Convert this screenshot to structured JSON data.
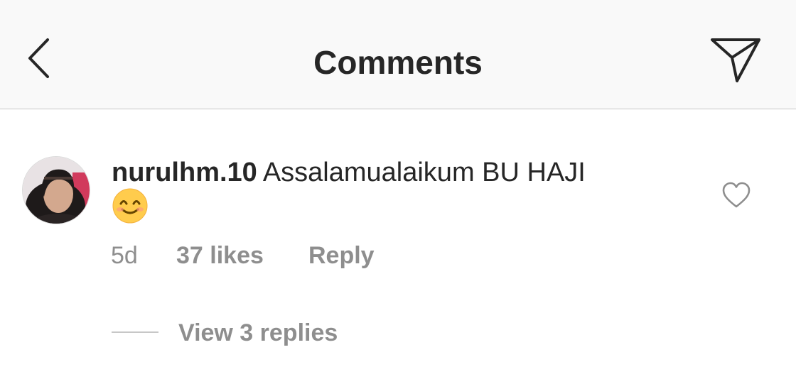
{
  "header": {
    "title": "Comments",
    "back_icon": "chevron-left-icon",
    "share_icon": "paper-plane-icon"
  },
  "comment": {
    "username": "nurulhm.10",
    "text": "Assalamualaikum BU HAJI",
    "emoji": "smiling-face-emoji",
    "time": "5d",
    "likes": "37 likes",
    "reply_label": "Reply",
    "like_icon": "heart-outline-icon",
    "view_replies_label": "View 3 replies"
  },
  "colors": {
    "header_bg": "#f9f9f9",
    "text_primary": "#262626",
    "text_secondary": "#8e8e8e",
    "divider": "#c8c8c8"
  }
}
